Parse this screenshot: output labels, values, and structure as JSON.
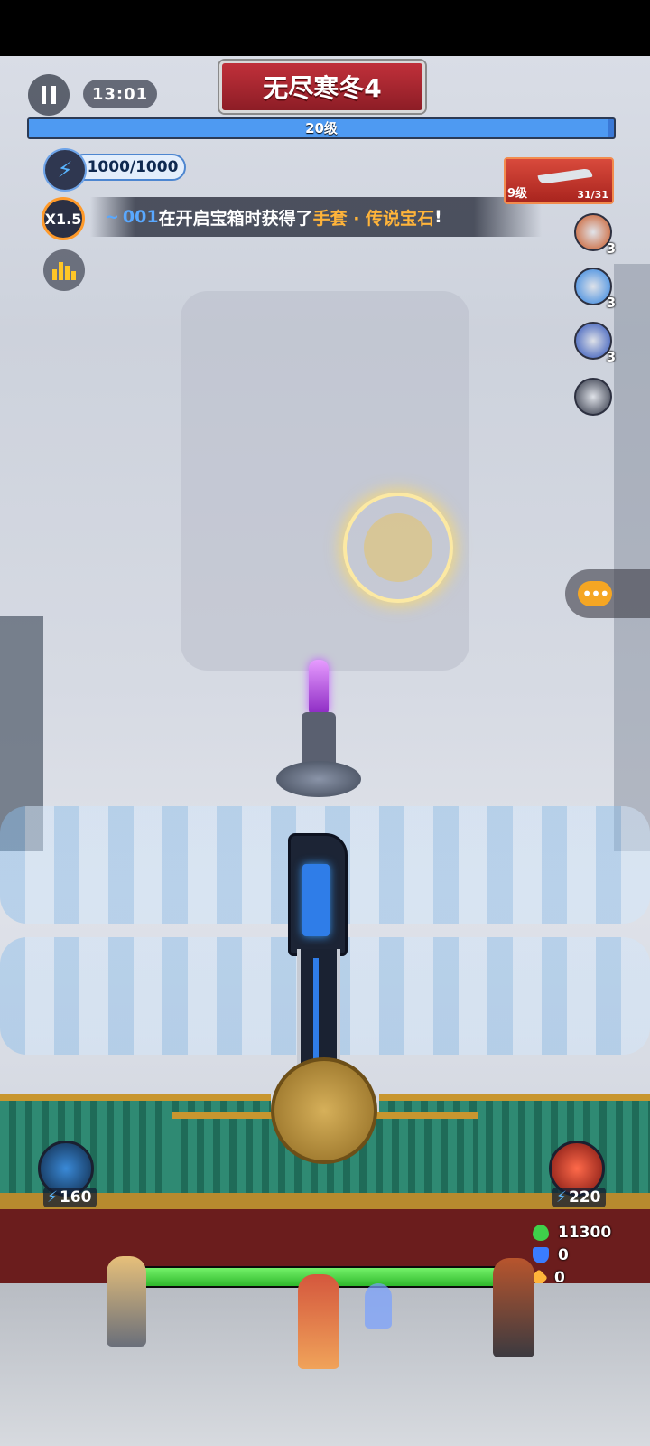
{
  "hud": {
    "timer": "13:01",
    "stage_title": "无尽寒冬4",
    "level_label": "20级",
    "level_progress": 0.99,
    "energy": "1000/1000",
    "speed": "X1.5"
  },
  "broadcast": {
    "prefix": "~",
    "player": "001",
    "text1": "在开启宝箱时获得了",
    "item": "手套 · 传说宝石",
    "suffix": "!"
  },
  "weapon": {
    "level": "9级",
    "count": "31/31"
  },
  "skills": [
    {
      "icon": "earth-skill-icon",
      "count": "3",
      "color": "#c9541f"
    },
    {
      "icon": "ice-burst-skill-icon",
      "count": "3",
      "color": "#2e82e0"
    },
    {
      "icon": "frost-blade-skill-icon",
      "count": "3",
      "color": "#2a4fb8"
    },
    {
      "icon": "target-skill-icon",
      "count": "",
      "color": "#2b3040"
    }
  ],
  "heroes": {
    "left_cost": "160",
    "right_cost": "220"
  },
  "resources": {
    "health": "11300",
    "shield": "0",
    "armor": "0",
    "health_color": "#3fd04a",
    "shield_color": "#3a7cff",
    "armor_color": "#ffb43a"
  },
  "base_hp_fraction": 1.0
}
